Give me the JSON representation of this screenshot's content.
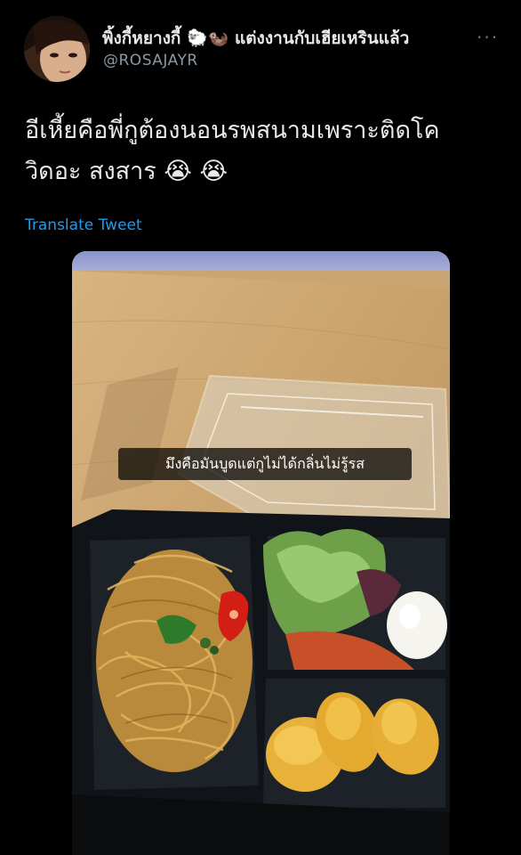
{
  "tweet": {
    "display_name": "พิ้งกี้หยางกี้ 🐑🦦 แต่งงานกับเฮียเหรินแล้ว",
    "handle": "@ROSAJAYR",
    "more_label": "···",
    "text_line1": "อีเหี้ยคือพี่กูต้องนอนรพสนามเพราะติดโค",
    "text_line2": "วิดอะ สงสาร 😭 😭",
    "translate_label": "Translate Tweet"
  },
  "media": {
    "caption": "มึงคือมันบูดแต่กูไม่ได้กลิ่นไม่รู้รส"
  },
  "colors": {
    "background": "#000000",
    "text": "#e7e9ea",
    "muted": "#8b98a5",
    "link": "#1d9bf0"
  },
  "icons": {
    "more": "more-dots-icon"
  }
}
